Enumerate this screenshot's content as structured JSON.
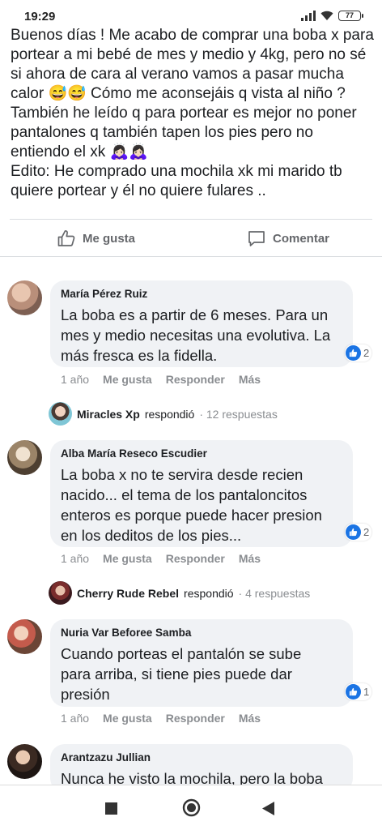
{
  "status_bar": {
    "time": "19:29",
    "battery": "77"
  },
  "post": {
    "lines": [
      "Buenos días ! Me acabo de comprar una boba x para",
      "portear a mi bebé de mes y medio y 4kg, pero no sé",
      "si ahora de cara al verano vamos a pasar mucha",
      "calor 😅😅 Cómo me aconsejáis q vista al niño ?",
      "También he leído q para portear es mejor no poner",
      "pantalones q también tapen los pies pero no",
      "entiendo el xk 🙇🏻‍♀️🙇🏻‍♀️",
      "Edito: He comprado una mochila xk mi marido tb",
      "quiere portear y él no quiere fulares .."
    ]
  },
  "actions": {
    "like_label": "Me gusta",
    "comment_label": "Comentar"
  },
  "comment_meta": {
    "time": "1 año",
    "like": "Me gusta",
    "reply": "Responder",
    "more": "Más"
  },
  "comments": [
    {
      "author": "María Pérez Ruiz",
      "lines": [
        "La boba es a partir de 6 meses. Para un",
        "mes y medio necesitas una evolutiva. La",
        "más fresca es la fidella."
      ],
      "reactions": "2",
      "reply": {
        "name": "Miracles Xp",
        "verb": "respondió",
        "count": "· 12 respuestas"
      }
    },
    {
      "author": "Alba María Reseco Escudier",
      "lines": [
        "La boba x no te servira desde recien",
        "nacido... el tema de los pantaloncitos",
        "enteros es porque puede hacer presion",
        "en los deditos de los pies..."
      ],
      "reactions": "2",
      "reply": {
        "name": "Cherry Rude Rebel",
        "verb": "respondió",
        "count": "· 4 respuestas"
      }
    },
    {
      "author": "Nuria Var Beforee Samba",
      "lines": [
        "Cuando porteas el pantalón se sube",
        "para arriba, si tiene pies puede dar",
        "presión"
      ],
      "reactions": "1"
    },
    {
      "author": "Arantzazu Jullian",
      "lines": [
        "Nunca he visto la mochila, pero la boba"
      ]
    }
  ],
  "colors": {
    "accent": "#1b74e4",
    "bubble": "#f0f2f5",
    "muted": "#8a8d91"
  },
  "icons": {
    "like": "thumbs-up-icon",
    "comment": "comment-icon",
    "nav_back": "back-triangle-icon",
    "nav_home": "home-circle-icon",
    "nav_recents": "recents-square-icon"
  }
}
